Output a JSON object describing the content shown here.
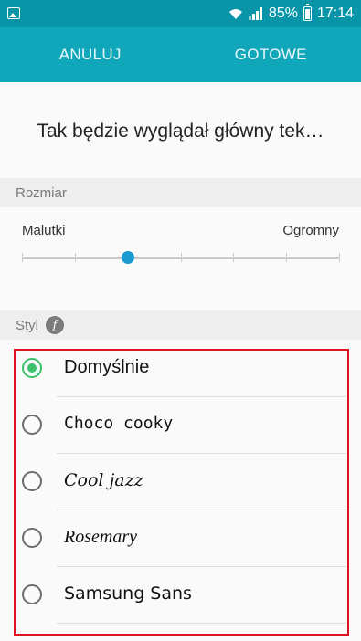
{
  "status_bar": {
    "battery": "85%",
    "time": "17:14",
    "icons": [
      "image-notification-icon",
      "wifi-icon",
      "signal-icon",
      "battery-icon"
    ]
  },
  "action_bar": {
    "cancel_label": "ANULUJ",
    "done_label": "GOTOWE"
  },
  "preview": {
    "text": "Tak będzie wyglądał główny tek…"
  },
  "size": {
    "header": "Rozmiar",
    "min_label": "Malutki",
    "max_label": "Ogromny",
    "steps": 7,
    "selected_index": 2
  },
  "style": {
    "header": "Styl",
    "header_icon": "font-style-icon",
    "selected": "Domyślnie",
    "options": [
      {
        "label": "Domyślnie",
        "selected": true
      },
      {
        "label": "Choco cooky",
        "selected": false
      },
      {
        "label": "Cool jazz",
        "selected": false
      },
      {
        "label": "Rosemary",
        "selected": false
      },
      {
        "label": "Samsung Sans",
        "selected": false
      }
    ]
  },
  "colors": {
    "status_bar": "#0895a8",
    "action_bar": "#11a7bb",
    "accent_slider": "#1a9bd2",
    "radio_selected": "#3cc06b",
    "highlight_border": "#e0141e"
  }
}
